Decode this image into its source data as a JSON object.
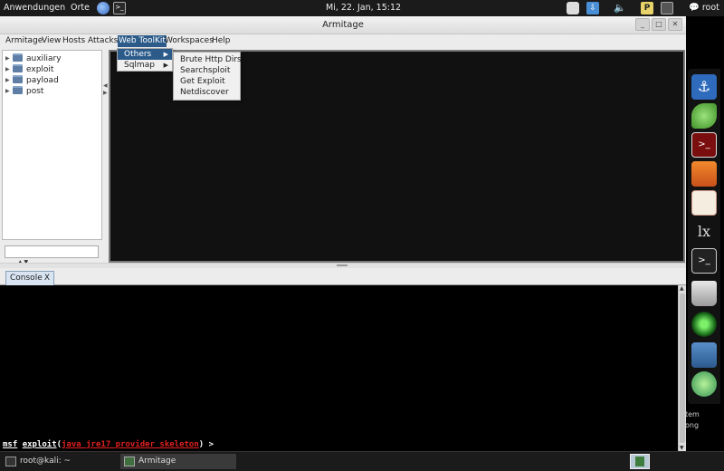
{
  "top_panel": {
    "applications": "Anwendungen",
    "places": "Orte",
    "clock": "Mi, 22. Jan, 15:12",
    "user": "root"
  },
  "window": {
    "title": "Armitage",
    "minimize": "_",
    "maximize": "□",
    "close": "✕"
  },
  "menubar": {
    "items": [
      "Armitage",
      "View",
      "Hosts",
      "Attacks",
      "Web ToolKit",
      "Workspaces",
      "Help"
    ],
    "active": "Web ToolKit"
  },
  "web_toolkit_menu": {
    "items": [
      {
        "label": "Others",
        "submenu": true
      },
      {
        "label": "Sqlmap",
        "submenu": true
      }
    ],
    "highlighted": "Others"
  },
  "others_submenu": {
    "items": [
      "Brute Http Dirs",
      "Searchsploit",
      "Get Exploit",
      "Netdiscover"
    ]
  },
  "module_tree": {
    "nodes": [
      "auxiliary",
      "exploit",
      "payload",
      "post"
    ],
    "search_value": ""
  },
  "console": {
    "tab_label": "Console",
    "tab_close": "X",
    "prompt_prefix": "msf",
    "prompt_word": "exploit",
    "prompt_module": "java_jre17_provider_skeleton",
    "prompt_suffix": ">"
  },
  "dock": {
    "items": [
      "anchor-icon",
      "leaf-icon",
      "terminal-red-icon",
      "bag-icon",
      "document-icon",
      "tex-icon",
      "terminal-icon",
      "trash-icon",
      "radar-icon",
      "network-icon",
      "compass-icon"
    ],
    "side_text": [
      "tem",
      "ong"
    ]
  },
  "taskbar": {
    "items": [
      "root@kali: ~",
      "Armitage"
    ]
  },
  "colors": {
    "menu_highlight": "#2c5b8a",
    "module_name": "#e02020"
  }
}
